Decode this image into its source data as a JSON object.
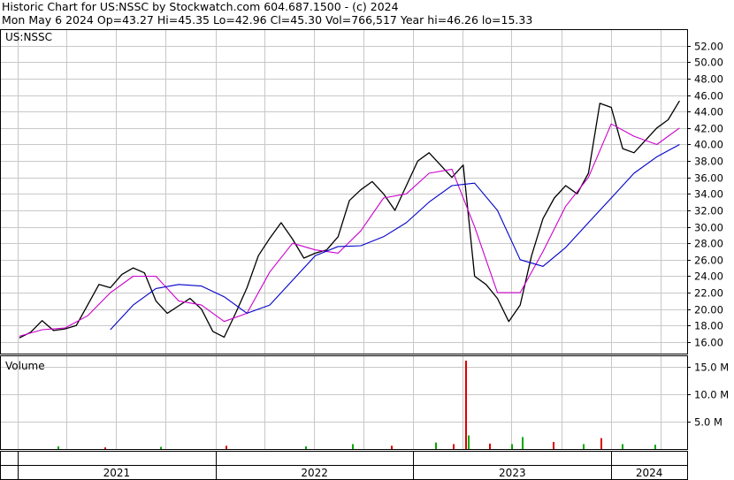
{
  "header": {
    "line1": "Historic Chart for US:NSSC by Stockwatch.com 604.687.1500 - (c) 2024",
    "line2": "Mon May  6 2024   Op=43.27   Hi=45.35   Lo=42.96   Cl=45.30   Vol=766,517   Year hi=46.26   lo=15.33"
  },
  "chart_data": [
    {
      "type": "line",
      "title": "US:NSSC",
      "xlabel": "",
      "ylabel": "",
      "x_categories": [
        "2021",
        "2022",
        "2023",
        "2024"
      ],
      "y_ticks": [
        "52.00",
        "50.00",
        "48.00",
        "46.00",
        "44.00",
        "42.00",
        "40.00",
        "38.00",
        "36.00",
        "34.00",
        "32.00",
        "30.00",
        "28.00",
        "26.00",
        "24.00",
        "22.00",
        "20.00",
        "18.00",
        "16.00"
      ],
      "ylim": [
        14.6,
        53.9
      ],
      "grid": true,
      "colors": {
        "price": "#000000",
        "ma_short": "#cc00cc",
        "ma_long": "#0000cc",
        "grid": "#c8c8c8"
      },
      "series": [
        {
          "role": "price",
          "x": [
            "2021-01-04",
            "2021-01-25",
            "2021-02-15",
            "2021-03-08",
            "2021-03-29",
            "2021-04-19",
            "2021-05-10",
            "2021-05-31",
            "2021-06-21",
            "2021-07-12",
            "2021-08-02",
            "2021-08-23",
            "2021-09-13",
            "2021-10-04",
            "2021-10-25",
            "2021-11-15",
            "2021-12-06",
            "2021-12-27",
            "2022-01-17",
            "2022-02-07",
            "2022-02-28",
            "2022-03-21",
            "2022-04-11",
            "2022-05-02",
            "2022-05-23",
            "2022-06-13",
            "2022-07-04",
            "2022-07-25",
            "2022-08-15",
            "2022-09-05",
            "2022-09-26",
            "2022-10-17",
            "2022-11-07",
            "2022-11-28",
            "2022-12-19",
            "2023-01-09",
            "2023-01-30",
            "2023-02-20",
            "2023-03-13",
            "2023-04-03",
            "2023-04-24",
            "2023-05-15",
            "2023-06-05",
            "2023-06-26",
            "2023-07-17",
            "2023-08-07",
            "2023-08-28",
            "2023-09-18",
            "2023-10-09",
            "2023-10-30",
            "2023-11-20",
            "2023-12-11",
            "2024-01-01",
            "2024-01-22",
            "2024-02-12",
            "2024-03-04",
            "2024-03-25",
            "2024-04-15",
            "2024-05-06"
          ],
          "values": [
            16.5,
            17.2,
            18.6,
            17.4,
            17.6,
            18.0,
            20.5,
            23.0,
            22.6,
            24.2,
            25.0,
            24.4,
            21.0,
            19.5,
            20.4,
            21.3,
            20.0,
            17.3,
            16.6,
            19.5,
            22.6,
            26.5,
            28.6,
            30.5,
            28.5,
            26.2,
            26.8,
            27.2,
            28.8,
            33.2,
            34.5,
            35.5,
            34.0,
            32.0,
            35.0,
            38.0,
            39.0,
            37.5,
            36.0,
            37.5,
            24.0,
            23.0,
            21.3,
            18.5,
            20.5,
            26.5,
            31.0,
            33.5,
            35.0,
            34.0,
            36.5,
            45.0,
            44.5,
            39.5,
            39.0,
            40.5,
            42.0,
            43.0,
            45.3
          ]
        },
        {
          "role": "ma_short",
          "x": [
            "2021-01-04",
            "2021-02-15",
            "2021-03-29",
            "2021-05-10",
            "2021-06-21",
            "2021-08-02",
            "2021-09-13",
            "2021-10-25",
            "2021-12-06",
            "2022-01-17",
            "2022-02-28",
            "2022-04-11",
            "2022-05-23",
            "2022-07-04",
            "2022-08-15",
            "2022-09-26",
            "2022-11-07",
            "2022-12-19",
            "2023-01-30",
            "2023-03-13",
            "2023-04-24",
            "2023-06-05",
            "2023-07-17",
            "2023-08-28",
            "2023-10-09",
            "2023-11-20",
            "2024-01-01",
            "2024-02-12",
            "2024-03-25",
            "2024-05-06"
          ],
          "values": [
            16.7,
            17.5,
            17.7,
            19.2,
            22.0,
            24.0,
            24.0,
            21.0,
            20.5,
            18.5,
            19.5,
            24.5,
            28.0,
            27.2,
            26.8,
            29.5,
            33.5,
            34.0,
            36.5,
            37.0,
            30.0,
            22.0,
            22.0,
            27.0,
            32.5,
            36.0,
            42.5,
            41.0,
            40.0,
            42.0
          ]
        },
        {
          "role": "ma_long",
          "x": [
            "2021-06-21",
            "2021-08-02",
            "2021-09-13",
            "2021-10-25",
            "2021-12-06",
            "2022-01-17",
            "2022-02-28",
            "2022-04-11",
            "2022-05-23",
            "2022-07-04",
            "2022-08-15",
            "2022-09-26",
            "2022-11-07",
            "2022-12-19",
            "2023-01-30",
            "2023-03-13",
            "2023-04-24",
            "2023-06-05",
            "2023-07-17",
            "2023-08-28",
            "2023-10-09",
            "2023-11-20",
            "2024-01-01",
            "2024-02-12",
            "2024-03-25",
            "2024-05-06"
          ],
          "values": [
            17.5,
            20.5,
            22.5,
            23.0,
            22.8,
            21.5,
            19.5,
            20.5,
            23.5,
            26.5,
            27.6,
            27.7,
            28.8,
            30.5,
            33.0,
            35.0,
            35.3,
            32.0,
            26.0,
            25.2,
            27.5,
            30.5,
            33.5,
            36.5,
            38.5,
            40.0
          ]
        }
      ]
    },
    {
      "type": "bar",
      "title": "Volume",
      "y_ticks": [
        "15.0 M",
        "10.0 M",
        "5.0 M"
      ],
      "ylim": [
        0,
        17.0
      ],
      "unit": "M",
      "colors": {
        "up": "#00aa00",
        "down": "#dd0000"
      },
      "x": [
        "2021-03-15",
        "2021-06-10",
        "2021-09-20",
        "2022-01-20",
        "2022-06-15",
        "2022-09-10",
        "2022-11-20",
        "2023-02-10",
        "2023-03-15",
        "2023-04-06",
        "2023-04-12",
        "2023-05-20",
        "2023-06-30",
        "2023-07-20",
        "2023-09-15",
        "2023-11-10",
        "2023-12-12",
        "2024-01-20",
        "2024-03-20"
      ],
      "values": [
        0.5,
        0.3,
        0.4,
        0.6,
        0.5,
        0.9,
        0.6,
        1.2,
        0.9,
        16.2,
        2.5,
        1.0,
        0.9,
        2.2,
        1.3,
        0.9,
        2.0,
        0.9,
        0.8
      ],
      "direction": [
        "up",
        "down",
        "up",
        "down",
        "up",
        "up",
        "down",
        "up",
        "down",
        "down",
        "up",
        "down",
        "up",
        "up",
        "down",
        "up",
        "down",
        "up",
        "up"
      ]
    }
  ]
}
